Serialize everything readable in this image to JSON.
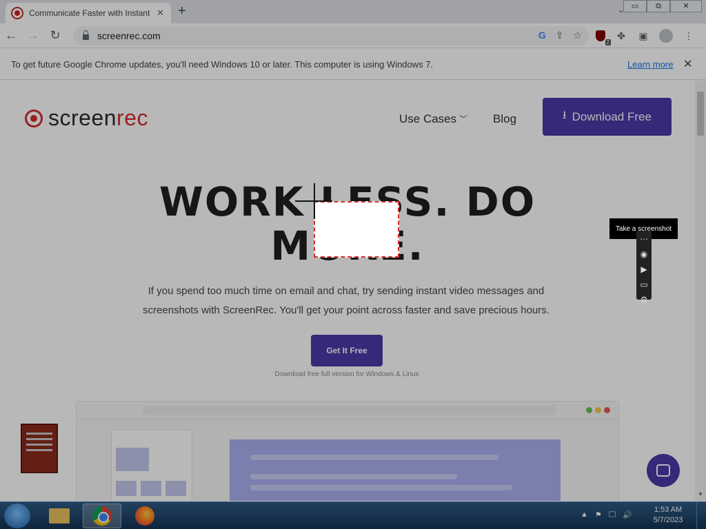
{
  "browser": {
    "tab_title": "Communicate Faster with Instant",
    "tab_close": "✕",
    "new_tab": "+",
    "tab_list": "⌄",
    "url": "screenrec.com",
    "win_min": "▭",
    "win_restore": "⧉",
    "win_close": "✕",
    "back": "←",
    "forward": "→",
    "reload": "↻",
    "ext_badge": "2"
  },
  "infobar": {
    "message": "To get future Google Chrome updates, you'll need Windows 10 or later. This computer is using Windows 7.",
    "link": "Learn more",
    "close": "✕"
  },
  "site": {
    "logo_plain": "screen",
    "logo_accent": "rec",
    "nav": {
      "use_cases": "Use Cases",
      "blog": "Blog",
      "download_button": "Download Free"
    },
    "hero_line1": "WORK LESS. DO",
    "hero_line2": "MORE.",
    "subtitle": "If you spend too much time on email and chat, try sending instant video messages and screenshots with ScreenRec. You'll get your point across faster and save precious hours.",
    "cta": "Get It Free",
    "cta_note": "Download free full version for Windows & Linux"
  },
  "capture_tool": {
    "tooltip": "Take a screenshot"
  },
  "taskbar": {
    "time": "1:53 AM",
    "date": "5/7/2023"
  },
  "colors": {
    "brand_purple": "#4a3aa8",
    "brand_red": "#d32f2f"
  }
}
